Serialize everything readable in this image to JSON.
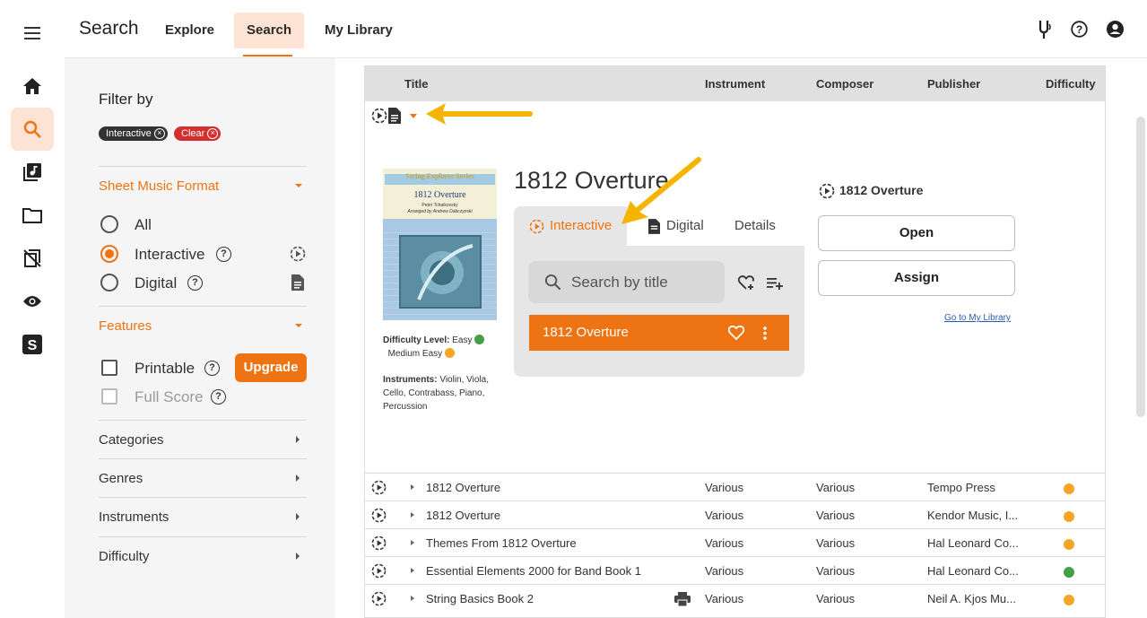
{
  "colors": {
    "accent": "#ee7413",
    "accent_light": "#fde3d3",
    "easy": "#43a047",
    "medium_easy": "#f5a623"
  },
  "topbar": {
    "title": "Search",
    "tabs": [
      {
        "label": "Explore"
      },
      {
        "label": "Search"
      },
      {
        "label": "My Library"
      }
    ],
    "icons": [
      "tuning-fork-icon",
      "help-icon",
      "account-icon"
    ]
  },
  "rail": {
    "icons": [
      "menu-icon",
      "home-icon",
      "search-icon",
      "music-library-icon",
      "folder-icon",
      "assignment-icon",
      "eye-icon",
      "s-logo-icon"
    ]
  },
  "filter": {
    "heading": "Filter by",
    "chips": [
      {
        "label": "Interactive"
      },
      {
        "label": "Clear"
      }
    ],
    "format": {
      "title": "Sheet Music Format",
      "options": [
        {
          "label": "All",
          "selected": false
        },
        {
          "label": "Interactive",
          "selected": true
        },
        {
          "label": "Digital",
          "selected": false
        }
      ]
    },
    "features": {
      "title": "Features",
      "options": [
        {
          "label": "Printable",
          "checked": false
        },
        {
          "label": "Full Score",
          "checked": false,
          "disabled": true
        }
      ],
      "upgrade_label": "Upgrade"
    },
    "collapsed_sections": [
      {
        "label": "Categories"
      },
      {
        "label": "Genres"
      },
      {
        "label": "Instruments"
      },
      {
        "label": "Difficulty"
      }
    ]
  },
  "table": {
    "columns": [
      "Title",
      "Instrument",
      "Composer",
      "Publisher",
      "Difficulty"
    ],
    "rows": [
      {
        "title": "1812 Overture",
        "instrument": "Various",
        "composer": "Various",
        "publisher": "Tempo Press",
        "difficulty": "medium_easy"
      },
      {
        "title": "1812 Overture",
        "instrument": "Various",
        "composer": "Various",
        "publisher": "Kendor Music, I...",
        "difficulty": "medium_easy"
      },
      {
        "title": "Themes From 1812 Overture",
        "instrument": "Various",
        "composer": "Various",
        "publisher": "Hal Leonard Co...",
        "difficulty": "medium_easy"
      },
      {
        "title": "Essential Elements 2000 for Band Book 1",
        "instrument": "Various",
        "composer": "Various",
        "publisher": "Hal Leonard Co...",
        "difficulty": "easy"
      },
      {
        "title": "String Basics Book 2",
        "instrument": "Various",
        "composer": "Various",
        "publisher": "Neil A. Kjos Mu...",
        "difficulty": "medium_easy",
        "printable": true
      }
    ]
  },
  "detail": {
    "title": "1812 Overture",
    "cover": {
      "series": "String Explorer Series",
      "title": "1812 Overture",
      "credit1": "Peter Tchaikovsky",
      "credit2": "Arranged by Andrew Dabczynski"
    },
    "difficulty_label": "Difficulty Level:",
    "difficulty_values": [
      "Easy",
      "Medium Easy"
    ],
    "instruments_label": "Instruments:",
    "instruments_value": "Violin, Viola, Cello, Contrabass, Piano, Percussion",
    "tabs": [
      {
        "label": "Interactive"
      },
      {
        "label": "Digital"
      },
      {
        "label": "Details"
      }
    ],
    "search_placeholder": "Search by title",
    "selected_item": "1812 Overture",
    "side_title": "1812 Overture",
    "open_label": "Open",
    "assign_label": "Assign",
    "library_link": "Go to My Library"
  }
}
